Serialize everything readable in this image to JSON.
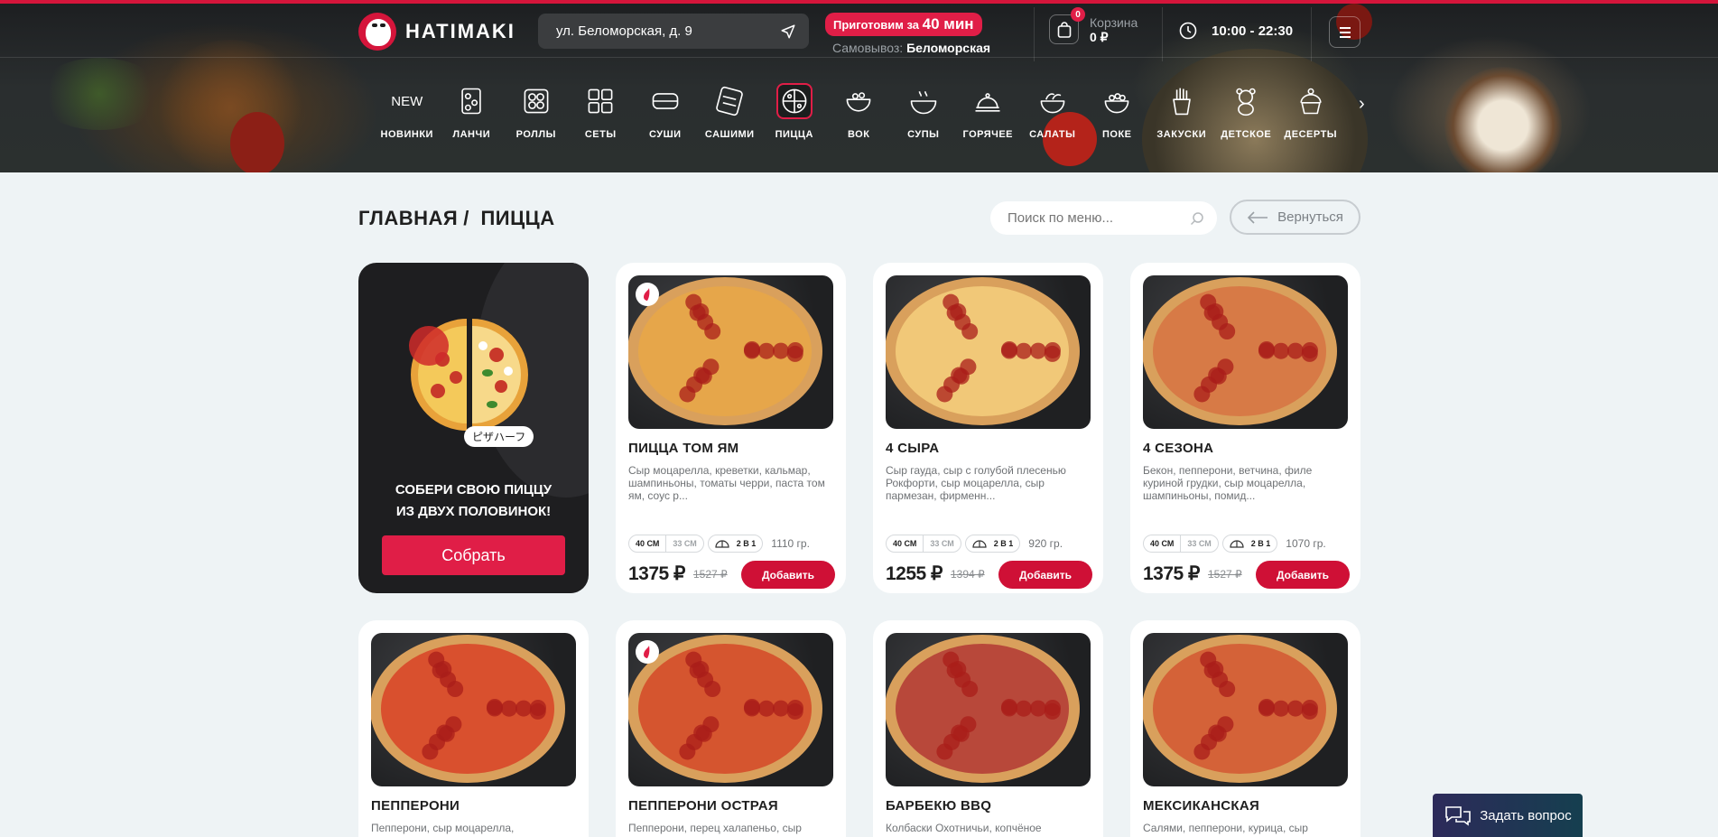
{
  "header": {
    "brand": "HATIMAKI",
    "address": "ул. Беломорская, д. 9",
    "prep_prefix": "Приготовим за",
    "prep_time": "40 мин",
    "pickup_label": "Самовывоз:",
    "pickup_place": "Беломорская",
    "cart_count": "0",
    "cart_label": "Корзина",
    "cart_sum": "0 ₽",
    "hours": "10:00 - 22:30"
  },
  "categories": [
    {
      "label": "НОВИНКИ",
      "icon": "new-icon",
      "badge": "NEW"
    },
    {
      "label": "ЛАНЧИ",
      "icon": "lunch-box-icon"
    },
    {
      "label": "РОЛЛЫ",
      "icon": "rolls-icon"
    },
    {
      "label": "СЕТЫ",
      "icon": "sets-icon"
    },
    {
      "label": "СУШИ",
      "icon": "sushi-icon"
    },
    {
      "label": "САШИМИ",
      "icon": "sashimi-icon"
    },
    {
      "label": "ПИЦЦА",
      "icon": "pizza-icon",
      "active": true
    },
    {
      "label": "ВОК",
      "icon": "wok-icon"
    },
    {
      "label": "СУПЫ",
      "icon": "soup-icon"
    },
    {
      "label": "ГОРЯЧЕЕ",
      "icon": "cloche-icon"
    },
    {
      "label": "САЛАТЫ",
      "icon": "salad-icon"
    },
    {
      "label": "ПОКЕ",
      "icon": "poke-bowl-icon"
    },
    {
      "label": "ЗАКУСКИ",
      "icon": "fries-icon"
    },
    {
      "label": "ДЕТСКОЕ",
      "icon": "teddy-bear-icon"
    },
    {
      "label": "ДЕСЕРТЫ",
      "icon": "cupcake-icon"
    }
  ],
  "breadcrumb": {
    "home": "ГЛАВНАЯ",
    "sep": "/",
    "current": "ПИЦЦА"
  },
  "search": {
    "placeholder": "Поиск по меню..."
  },
  "back_label": "Вернуться",
  "promo": {
    "tag": "ピザハーフ",
    "line1": "СОБЕРИ СВОЮ ПИЦЦУ",
    "line2": "ИЗ ДВУХ ПОЛОВИНОК!",
    "button": "Собрать"
  },
  "products": [
    {
      "title": "ПИЦЦА ТОМ ЯМ",
      "desc": "Сыр моцарелла, креветки, кальмар, шампиньоны, томаты черри, паста том ям, соус р...",
      "size_a": "40 СМ",
      "size_b": "33 СМ",
      "half": "2 В 1",
      "weight": "1110 гр.",
      "price": "1375 ₽",
      "old_price": "1527 ₽",
      "add": "Добавить",
      "spicy": true,
      "color": "#e6a64a"
    },
    {
      "title": "4 СЫРА",
      "desc": "Сыр гауда, сыр с голубой плесенью Рокфорти, сыр моцарелла, сыр пармезан, фирменн...",
      "size_a": "40 СМ",
      "size_b": "33 СМ",
      "half": "2 В 1",
      "weight": "920 гр.",
      "price": "1255 ₽",
      "old_price": "1394 ₽",
      "add": "Добавить",
      "spicy": false,
      "color": "#f1c878"
    },
    {
      "title": "4 СЕЗОНА",
      "desc": "Бекон, пепперони, ветчина, филе куриной грудки, сыр моцарелла, шампиньоны, помид...",
      "size_a": "40 СМ",
      "size_b": "33 СМ",
      "half": "2 В 1",
      "weight": "1070 гр.",
      "price": "1375 ₽",
      "old_price": "1527 ₽",
      "add": "Добавить",
      "spicy": false,
      "color": "#d77a46"
    },
    {
      "title": "ПЕППЕРОНИ",
      "desc": "Пепперони, сыр моцарелла,",
      "spicy": false,
      "color": "#d9502e"
    },
    {
      "title": "ПЕППЕРОНИ ОСТРАЯ",
      "desc": "Пепперони, перец халапеньо, сыр",
      "spicy": true,
      "color": "#d5552f"
    },
    {
      "title": "БАРБЕКЮ BBQ",
      "desc": "Колбаски Охотничьи, копчёное",
      "spicy": false,
      "color": "#b8483a"
    },
    {
      "title": "МЕКСИКАНСКАЯ",
      "desc": "Салями, пепперони, курица, сыр",
      "spicy": false,
      "color": "#d46238"
    }
  ],
  "ask_label": "Задать вопрос"
}
